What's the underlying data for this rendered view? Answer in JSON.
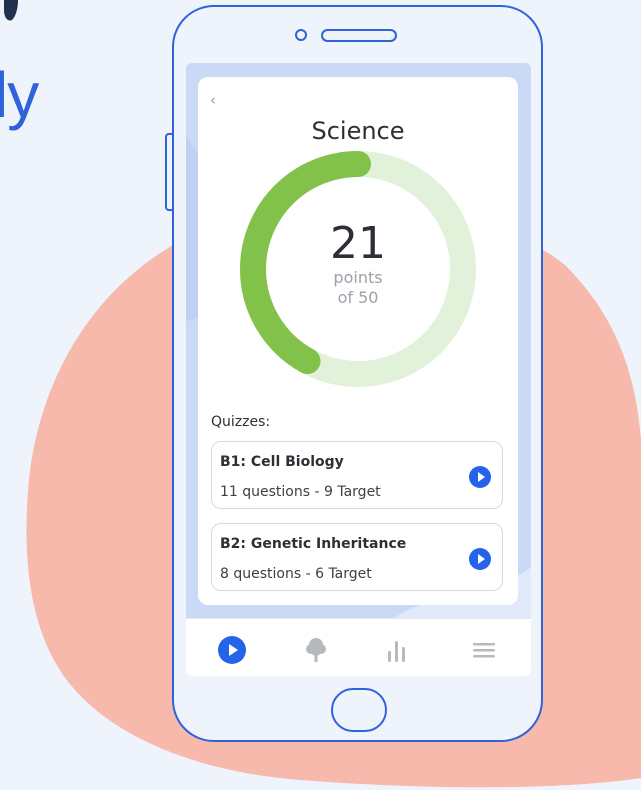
{
  "background": {
    "page_color": "#eef3fc",
    "blob_color": "#f6b9ab",
    "accent_color": "#2f63d9",
    "side_text": "ly"
  },
  "app": {
    "back_icon": "chevron-left-icon",
    "title": "Science",
    "score": {
      "value": "21",
      "unit": "points",
      "total": "of 50",
      "progress_fraction": 0.42,
      "track_color": "#e2f1da",
      "fill_color": "#82c24b"
    },
    "quizzes_heading": "Quizzes:",
    "quizzes": [
      {
        "name": "B1: Cell Biology",
        "meta": "11 questions - 9 Target",
        "icon": "play-icon"
      },
      {
        "name": "B2: Genetic Inheritance",
        "meta": "8 questions - 6 Target",
        "icon": "play-icon"
      }
    ],
    "nav": [
      {
        "icon": "play-icon",
        "active": true,
        "color": "#2563eb"
      },
      {
        "icon": "tree-icon",
        "active": false,
        "color": "#b6b9be"
      },
      {
        "icon": "bar-chart-icon",
        "active": false,
        "color": "#b6b9be"
      },
      {
        "icon": "menu-icon",
        "active": false,
        "color": "#b6b9be"
      }
    ]
  }
}
